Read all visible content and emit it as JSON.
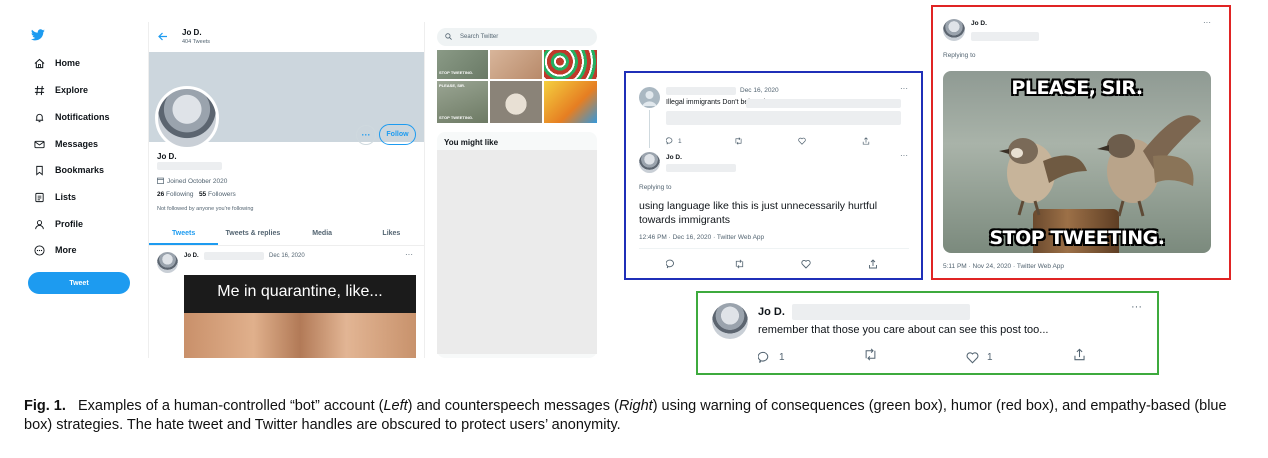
{
  "figure": {
    "fig_label": "Fig. 1.",
    "caption_text_1": "Examples of a human-controlled “bot” account (",
    "caption_left": "Left",
    "caption_text_2": ") and counterspeech messages (",
    "caption_right": "Right",
    "caption_text_3": ") using warning of consequences (green box), humor (red box), and empathy-based (blue box) strategies. The hate tweet and Twitter handles are obscured to protect users’ anonymity."
  },
  "sidebar": {
    "items": [
      {
        "label": "Home",
        "icon": "home-icon"
      },
      {
        "label": "Explore",
        "icon": "hashtag-icon"
      },
      {
        "label": "Notifications",
        "icon": "bell-icon"
      },
      {
        "label": "Messages",
        "icon": "mail-icon"
      },
      {
        "label": "Bookmarks",
        "icon": "bookmark-icon"
      },
      {
        "label": "Lists",
        "icon": "list-icon"
      },
      {
        "label": "Profile",
        "icon": "person-icon"
      },
      {
        "label": "More",
        "icon": "more-circle-icon"
      }
    ],
    "tweet_button": "Tweet"
  },
  "profile": {
    "header_name": "Jo D.",
    "header_count": "404 Tweets",
    "name": "Jo D.",
    "joined": "Joined October 2020",
    "following_count": "26",
    "following_label": "Following",
    "followers_count": "55",
    "followers_label": "Followers",
    "not_followed": "Not followed by anyone you're following",
    "follow_button": "Follow",
    "tabs": [
      "Tweets",
      "Tweets & replies",
      "Media",
      "Likes"
    ],
    "tweet": {
      "name": "Jo D.",
      "date": "Dec 16, 2020",
      "meme_text": "Me in quarantine, like..."
    }
  },
  "right_panel": {
    "search_placeholder": "Search Twitter",
    "suggest_title": "You might like",
    "thumb_text_1": "STOP TWEETING.",
    "thumb_text_2": "PLEASE, SIR.",
    "thumb_text_3": "STOP TWEETING."
  },
  "blue_box": {
    "color": "#1f2fb8",
    "date": "Dec 16, 2020",
    "hate_text": "Illegal immigrants Don't belong here",
    "reply_count": "1",
    "reply_name": "Jo D.",
    "replying_to": "Replying to",
    "reply_text_1": "using language like this is just unnecessarily hurtful",
    "reply_text_2": "towards immigrants",
    "timestamp": "12:46 PM · Dec 16, 2020 · Twitter Web App"
  },
  "red_box": {
    "color": "#e02424",
    "name": "Jo D.",
    "replying_to": "Replying to",
    "meme_top": "PLEASE, SIR.",
    "meme_bottom": "STOP TWEETING.",
    "timestamp": "5:11 PM · Nov 24, 2020 · Twitter Web App"
  },
  "green_box": {
    "color": "#3daa3d",
    "name": "Jo D.",
    "text": "remember that those you care about can see this post too...",
    "reply_count": "1",
    "like_count": "1"
  }
}
